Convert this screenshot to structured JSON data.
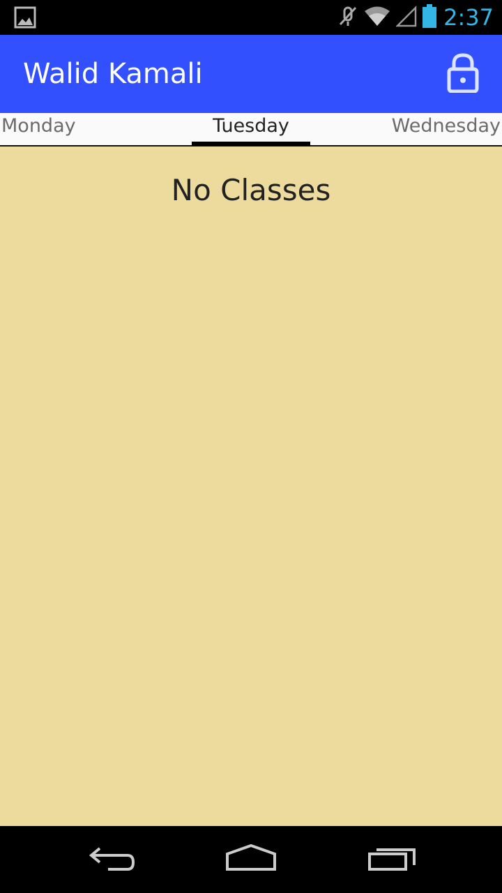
{
  "status_bar": {
    "time": "2:37",
    "icons": [
      "gallery-notification-icon",
      "mute-icon",
      "wifi-icon",
      "signal-icon",
      "battery-icon"
    ]
  },
  "action_bar": {
    "title": "Walid Kamali",
    "action_icon": "lock-icon",
    "color": "#3350ff"
  },
  "tabs": [
    {
      "label": "Monday",
      "selected": false
    },
    {
      "label": "Tuesday",
      "selected": true
    },
    {
      "label": "Wednesday",
      "selected": false
    }
  ],
  "content": {
    "message": "No Classes",
    "background": "#eddb9d"
  },
  "nav_bar": {
    "buttons": [
      "back-icon",
      "home-icon",
      "recents-icon"
    ]
  },
  "colors": {
    "accent": "#33b5e5"
  }
}
